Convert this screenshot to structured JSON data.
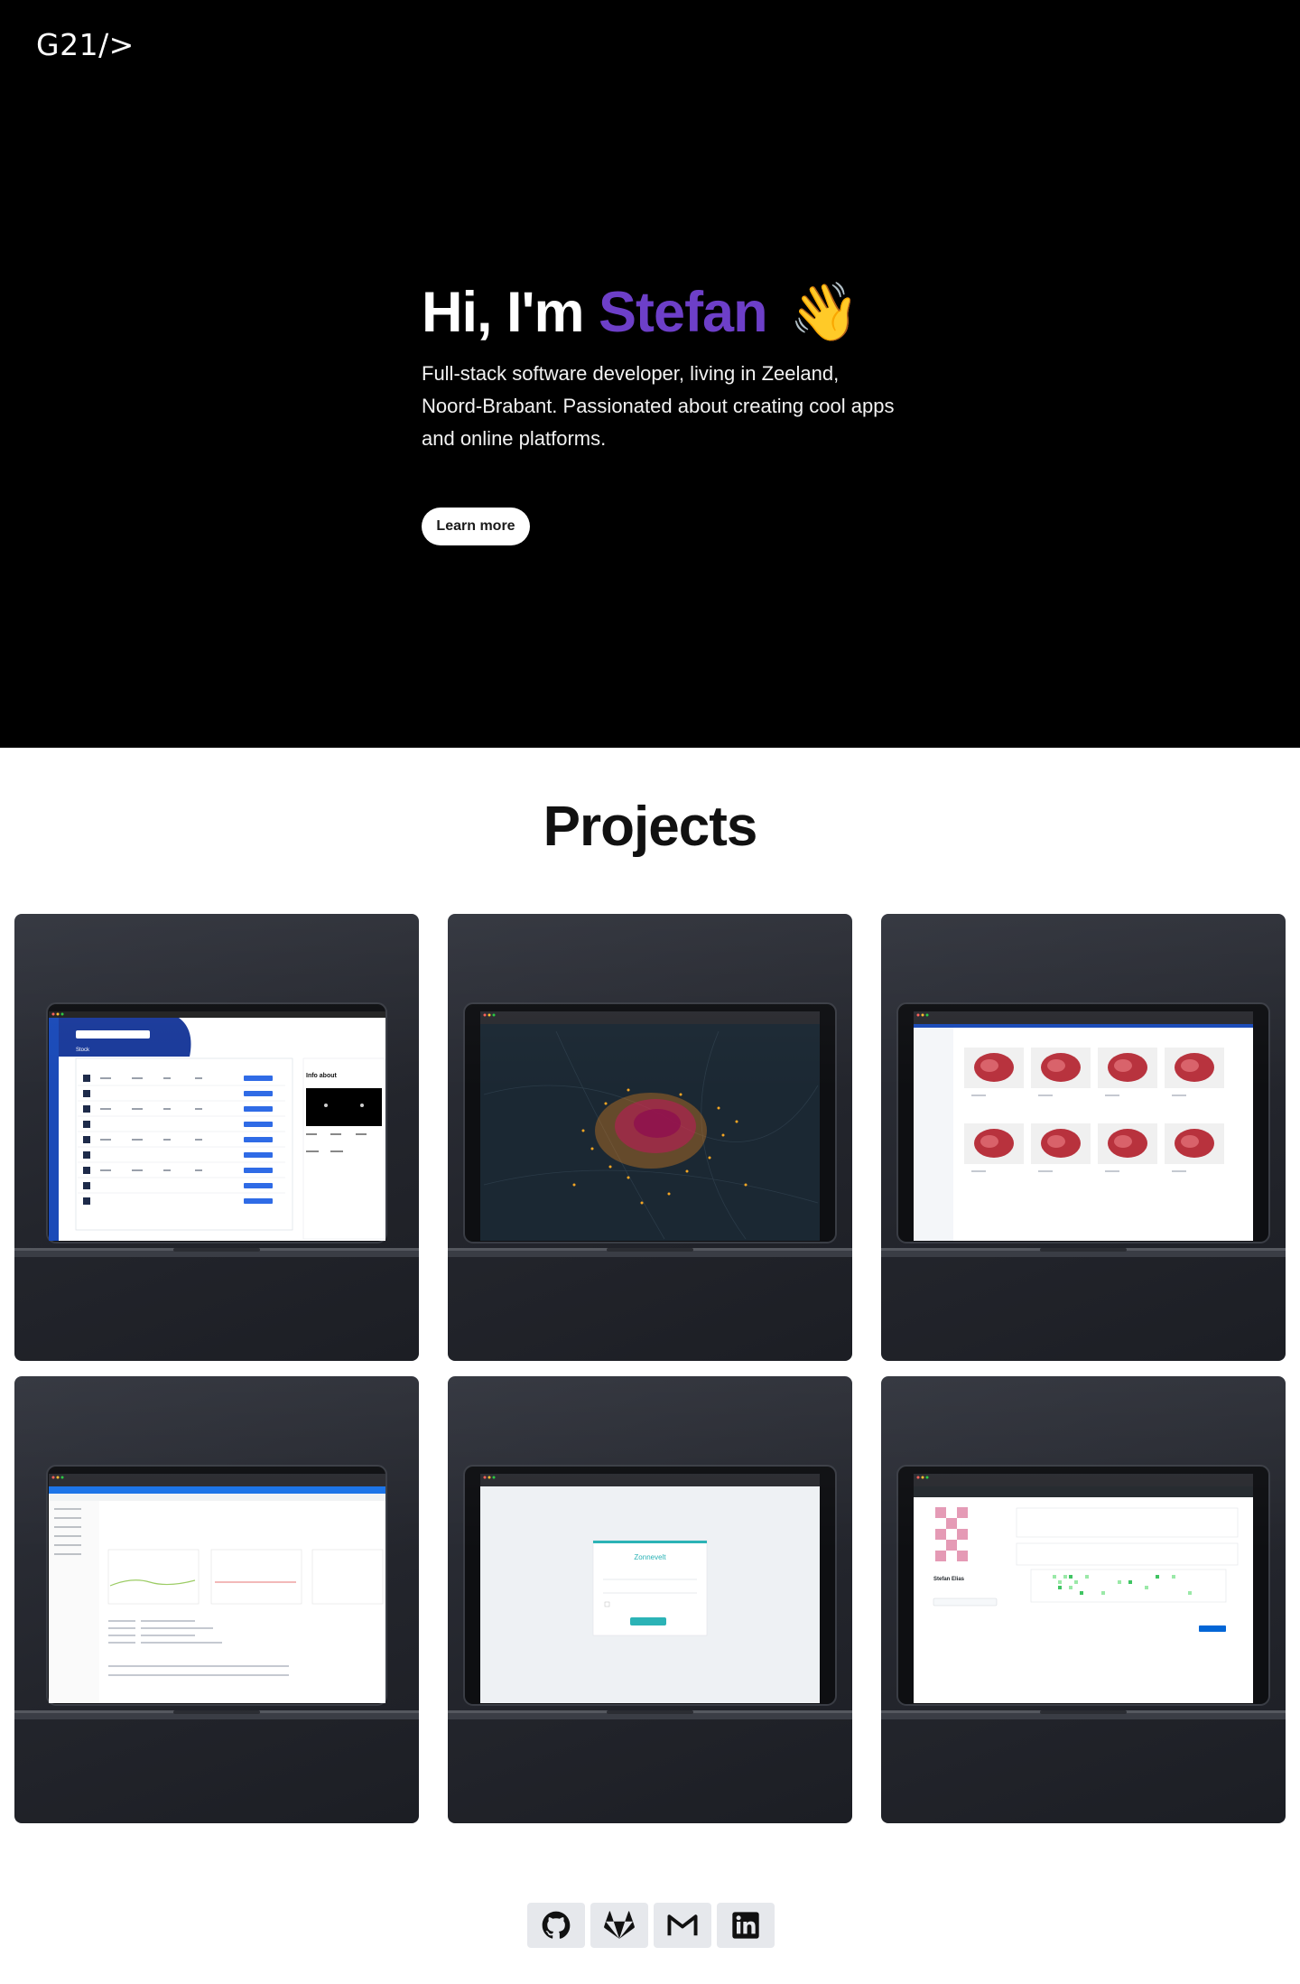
{
  "header": {
    "logo": "G21/>"
  },
  "hero": {
    "greeting": "Hi, I'm",
    "name": "Stefan",
    "wave": "👋",
    "description": "Full-stack software developer, living in Zeeland, Noord-Brabant. Passionated about creating cool apps and online platforms.",
    "button_label": "Learn more"
  },
  "projects": {
    "title": "Projects",
    "items": [
      {
        "screen": "stock-dashboard",
        "screen_labels": [
          "Stock",
          "Info about"
        ]
      },
      {
        "screen": "heatmap-city"
      },
      {
        "screen": "product-grid"
      },
      {
        "screen": "admin-console"
      },
      {
        "screen": "login-page",
        "screen_labels": [
          "Zonnevelt"
        ]
      },
      {
        "screen": "github-profile",
        "screen_labels": [
          "Stefan Elias"
        ]
      }
    ]
  },
  "socials": [
    {
      "icon": "github-icon",
      "name": "github"
    },
    {
      "icon": "gitlab-icon",
      "name": "gitlab"
    },
    {
      "icon": "gmail-icon",
      "name": "gmail"
    },
    {
      "icon": "linkedin-icon",
      "name": "linkedin"
    }
  ],
  "colors": {
    "accent": "#6d3fc8",
    "hero_bg": "#000000",
    "card_bg": "#2a2d35"
  }
}
